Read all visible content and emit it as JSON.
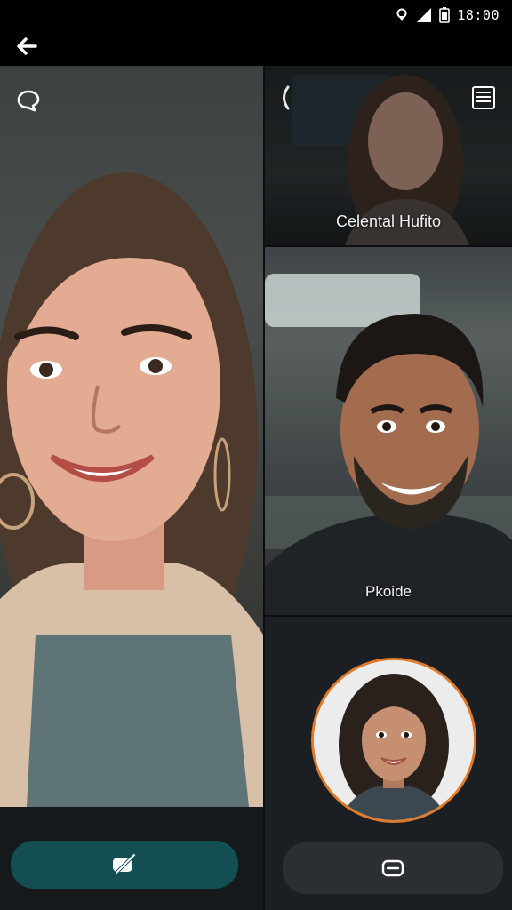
{
  "status_bar": {
    "time": "18:00"
  },
  "participants": [
    {
      "name": "Celental Hufito"
    },
    {
      "name": "Pkoide"
    }
  ],
  "colors": {
    "accent": "#e07b2a",
    "primary_button": "#134f52",
    "secondary_button": "#2b2f34"
  },
  "icons": {
    "back": "arrow-left-icon",
    "chat": "chat-bubble-icon",
    "flip": "camera-flip-icon",
    "list": "list-icon",
    "mute": "mic-off-icon",
    "video": "video-icon"
  }
}
